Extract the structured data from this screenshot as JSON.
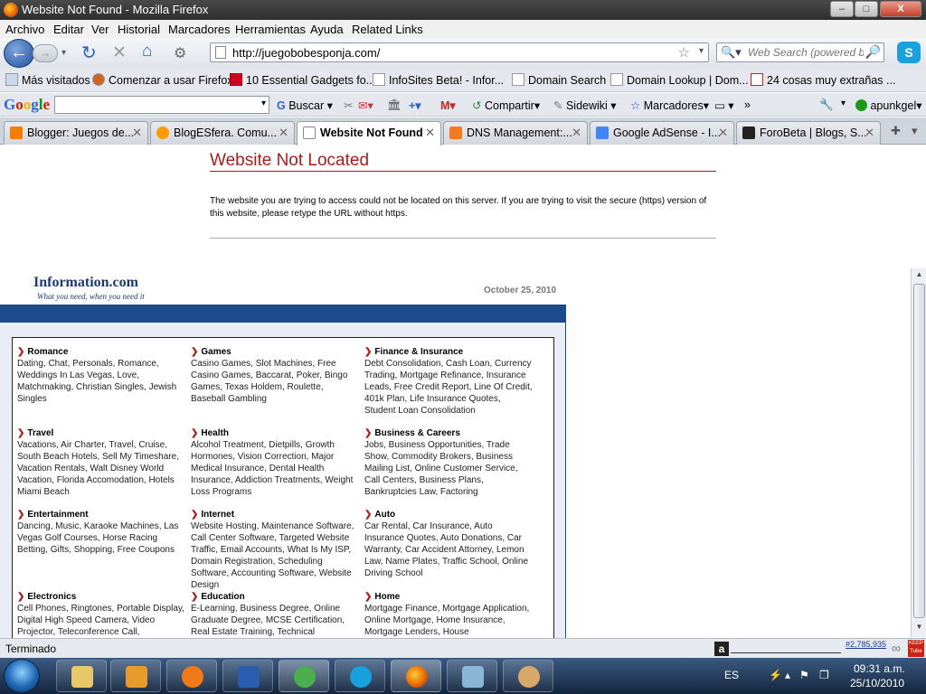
{
  "window": {
    "title": "Website Not Found - Mozilla Firefox",
    "min_label": "–",
    "max_label": "□",
    "close_label": "X"
  },
  "menu": [
    "Archivo",
    "Editar",
    "Ver",
    "Historial",
    "Marcadores",
    "Herramientas",
    "Ayuda",
    "Related Links"
  ],
  "nav": {
    "url": "http://juegobobesponja.com/",
    "search_placeholder": "Web Search (powered by",
    "icons": [
      "back-icon",
      "forward-icon",
      "reload-icon",
      "stop-icon",
      "home-icon",
      "addons-icon",
      "bookmark-star-icon",
      "search-icon"
    ]
  },
  "bookmarks": [
    "Más visitados",
    "Comenzar a usar Firefox",
    "10 Essential Gadgets fo...",
    "InfoSites Beta! - Infor...",
    "Domain Search",
    "Domain Lookup | Dom...",
    "24 cosas muy extrañas ..."
  ],
  "google_toolbar": {
    "logo": "Google",
    "buscar": "Buscar",
    "compartir": "Compartir",
    "sidewiki": "Sidewiki",
    "marcadores": "Marcadores",
    "more": "»",
    "user": "apunkgel"
  },
  "tabs": [
    {
      "label": "Blogger: Juegos de...",
      "color": "#f57d00"
    },
    {
      "label": "BlogESfera. Comu...",
      "color": "#ff9900"
    },
    {
      "label": "Website Not Found",
      "color": "#ffffff"
    },
    {
      "label": "DNS Management:...",
      "color": "#f47a20"
    },
    {
      "label": "Google AdSense - I...",
      "color": "#4285f4"
    },
    {
      "label": "ForoBeta | Blogs, S...",
      "color": "#222222"
    }
  ],
  "page": {
    "heading": "Website Not Located",
    "message": "The website you are trying to access could not be located on this server. If you are trying to visit the secure (https) version of this website, please retype the URL without https.",
    "info_logo": "Information.com",
    "info_tagline": "What you need, when you need it",
    "date": "October 25, 2010",
    "categories": [
      {
        "title": "Romance",
        "links": "Dating, Chat, Personals, Romance, Weddings In Las Vegas, Love, Matchmaking, Christian Singles, Jewish Singles"
      },
      {
        "title": "Games",
        "links": "Casino Games, Slot Machines, Free Casino Games, Baccarat, Poker, Bingo Games, Texas Holdem, Roulette, Baseball Gambling"
      },
      {
        "title": "Finance & Insurance",
        "links": "Debt Consolidation, Cash Loan, Currency Trading, Mortgage Refinance, Insurance Leads, Free Credit Report, Line Of Credit, 401k Plan, Life Insurance Quotes, Student Loan Consolidation"
      },
      {
        "title": "Travel",
        "links": "Vacations, Air Charter, Travel, Cruise, South Beach Hotels, Sell My Timeshare, Vacation Rentals, Walt Disney World Vacation, Florida Accomodation, Hotels Miami Beach"
      },
      {
        "title": "Health",
        "links": "Alcohol Treatment, Dietpills, Growth Hormones, Vision Correction, Major Medical Insurance, Dental Health Insurance, Addiction Treatments, Weight Loss Programs"
      },
      {
        "title": "Business & Careers",
        "links": "Jobs, Business Opportunities, Trade Show, Commodity Brokers, Business Mailing List, Online Customer Service, Call Centers, Business Plans, Bankruptcies Law, Factoring"
      },
      {
        "title": "Entertainment",
        "links": "Dancing, Music, Karaoke Machines, Las Vegas Golf Courses, Horse Racing Betting, Gifts, Shopping, Free Coupons"
      },
      {
        "title": "Internet",
        "links": "Website Hosting, Maintenance Software, Call Center Software, Targeted Website Traffic, Email Accounts, What Is My ISP, Domain Registration, Scheduling Software, Accounting Software, Website Design"
      },
      {
        "title": "Auto",
        "links": "Car Rental, Car Insurance, Auto Insurance Quotes, Auto Donations, Car Warranty, Car Accident Attorney, Lemon Law, Name Plates, Traffic School, Online Driving School"
      },
      {
        "title": "Electronics",
        "links": "Cell Phones, Ringtones, Portable Display, Digital High Speed Camera, Video Projector, Teleconference Call,"
      },
      {
        "title": "Education",
        "links": "E-Learning, Business Degree, Online Graduate Degree, MCSE Certification, Real Estate Training, Technical"
      },
      {
        "title": "Home",
        "links": "Mortgage Finance, Mortgage Application, Online Mortgage, Home Insurance, Mortgage Lenders, House"
      }
    ]
  },
  "status": {
    "text": "Terminado",
    "rank": "#2,785,935",
    "infinity": "∞",
    "keeptube": "KEEP Tube"
  },
  "taskbar": {
    "lang": "ES",
    "time": "09:31 a.m.",
    "date": "25/10/2010",
    "apps": [
      "explorer",
      "media-player",
      "avast",
      "word",
      "messenger",
      "skype",
      "firefox",
      "editor",
      "paint"
    ]
  }
}
